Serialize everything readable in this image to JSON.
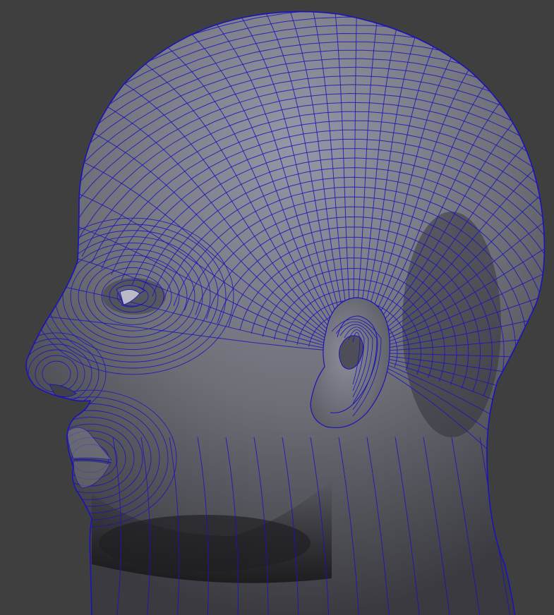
{
  "viewport": {
    "background_color": "#3f3f3f",
    "model": "head-side-profile-wireframe",
    "shading_light": "#9597a6",
    "shading_mid": "#6d6e76",
    "shading_dark": "#2e2e33",
    "wire_color": "#1c14b8"
  }
}
